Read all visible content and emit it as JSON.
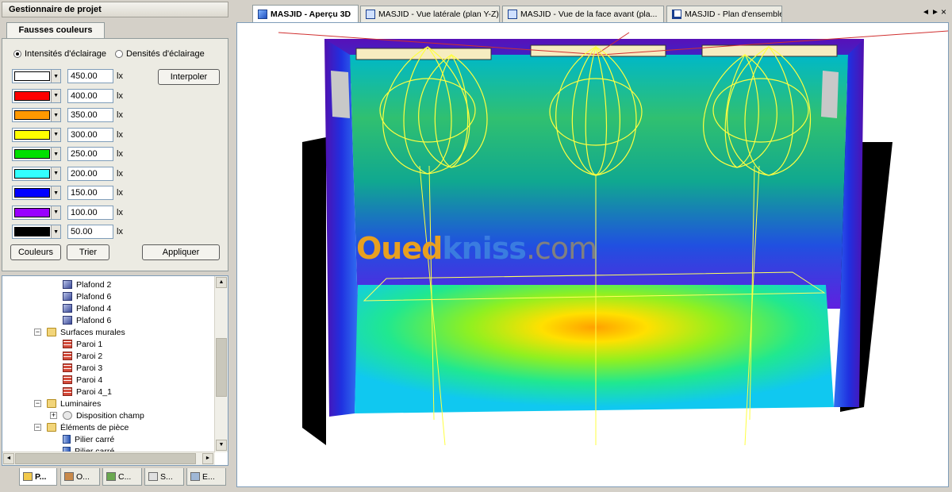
{
  "panel": {
    "title": "Gestionnaire de projet",
    "tab_label": "Fausses couleurs",
    "radio_intensities": "Intensités d'éclairage",
    "radio_densities": "Densités d'éclairage",
    "interpolate_button": "Interpoler",
    "colors_button": "Couleurs",
    "sort_button": "Trier",
    "apply_button": "Appliquer",
    "unit": "lx",
    "color_rows": [
      {
        "color": "#ffffff",
        "value": "450.00"
      },
      {
        "color": "#ff0000",
        "value": "400.00"
      },
      {
        "color": "#ff9900",
        "value": "350.00"
      },
      {
        "color": "#ffff00",
        "value": "300.00"
      },
      {
        "color": "#00e000",
        "value": "250.00"
      },
      {
        "color": "#33ffff",
        "value": "200.00"
      },
      {
        "color": "#0000ff",
        "value": "150.00"
      },
      {
        "color": "#9900ff",
        "value": "100.00"
      },
      {
        "color": "#000000",
        "value": "50.00"
      }
    ]
  },
  "tree": {
    "items": [
      {
        "label": "Plafond 2",
        "icon": "plafond"
      },
      {
        "label": "Plafond 6",
        "icon": "plafond"
      },
      {
        "label": "Plafond 4",
        "icon": "plafond"
      },
      {
        "label": "Plafond 6",
        "icon": "plafond"
      },
      {
        "label": "Surfaces murales",
        "icon": "folder"
      },
      {
        "label": "Paroi 1",
        "icon": "wall"
      },
      {
        "label": "Paroi 2",
        "icon": "wall"
      },
      {
        "label": "Paroi 3",
        "icon": "wall"
      },
      {
        "label": "Paroi 4",
        "icon": "wall"
      },
      {
        "label": "Paroi 4_1",
        "icon": "wall"
      },
      {
        "label": "Luminaires",
        "icon": "folder"
      },
      {
        "label": "Disposition champ",
        "icon": "gear"
      },
      {
        "label": "Éléments de pièce",
        "icon": "folder"
      },
      {
        "label": "Pilier carré",
        "icon": "pillar"
      },
      {
        "label": "Pilier carré",
        "icon": "pillar"
      }
    ]
  },
  "bottom_tabs": [
    "P...",
    "O...",
    "C...",
    "S...",
    "E..."
  ],
  "view_tabs": [
    {
      "label": "MASJID - Aperçu 3D",
      "active": true
    },
    {
      "label": "MASJID - Vue latérale (plan Y-Z)",
      "active": false
    },
    {
      "label": "MASJID - Vue de la face avant (pla...",
      "active": false
    },
    {
      "label": "MASJID - Plan d'ensemble",
      "active": false
    }
  ],
  "nav": {
    "left": "◄",
    "right": "►",
    "close": "×"
  },
  "watermark": {
    "part1": "Oued",
    "part2": "kniss",
    "part3": ".com"
  },
  "colors": {
    "accent": "#316ac5",
    "panel_bg": "#d4d0c8",
    "wire": "#ffff40"
  }
}
